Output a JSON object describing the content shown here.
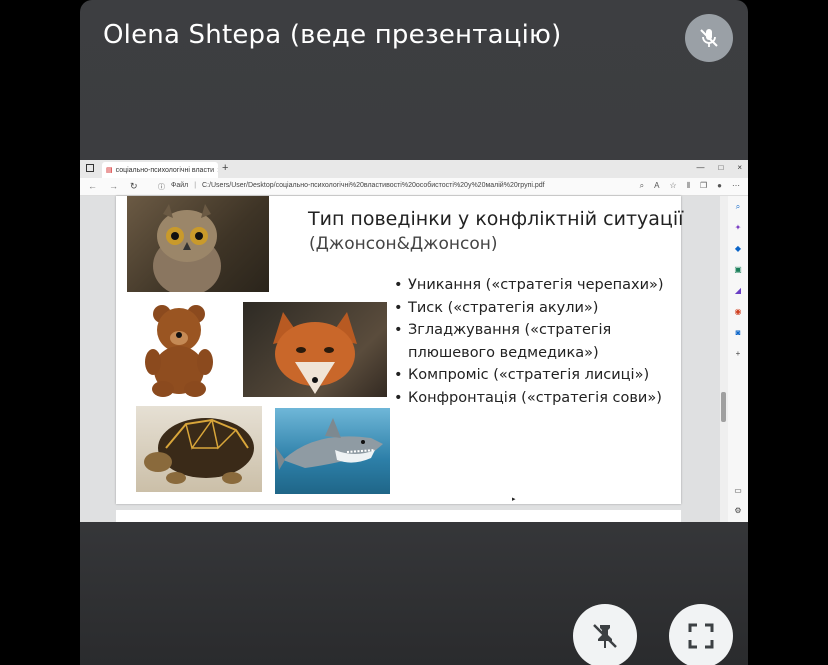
{
  "meeting": {
    "presenter_label": "Olena Shtepa (веде презентацію)",
    "mic_state_icon": "mic-off-icon",
    "pin_icon": "unpin-icon",
    "fullscreen_icon": "fullscreen-icon"
  },
  "browser": {
    "tab_title": "соціально-психологічні власти",
    "tab_close": "×",
    "new_tab": "+",
    "window_controls": [
      "—",
      "□",
      "×"
    ],
    "url_label": "Файл",
    "url_separator": "|",
    "url": "C:/Users/User/Desktop/соціально-психологічні%20властивості%20особистості%20у%20малій%20групі.pdf"
  },
  "slide": {
    "title": "Тип поведінки у конфліктній ситуації",
    "subtitle": "(Джонсон&Джонсон)",
    "bullets": [
      "Уникання («стратегія черепахи»)",
      "Тиск («стратегія акули»)",
      "Згладжування («стратегія плюшевого ведмедика»)",
      "Компроміс («стратегія лисиці»)",
      "Конфронтація («стратегія сови»)"
    ],
    "images": [
      "owl-image",
      "teddy-bear-image",
      "fox-image",
      "turtle-image",
      "shark-image"
    ]
  },
  "colors": {
    "tile_bg": "#3c3d40",
    "mic_bg": "#9aa0a6",
    "control_bg": "#f1f3f4",
    "edge_accent": "#0a64c8"
  }
}
